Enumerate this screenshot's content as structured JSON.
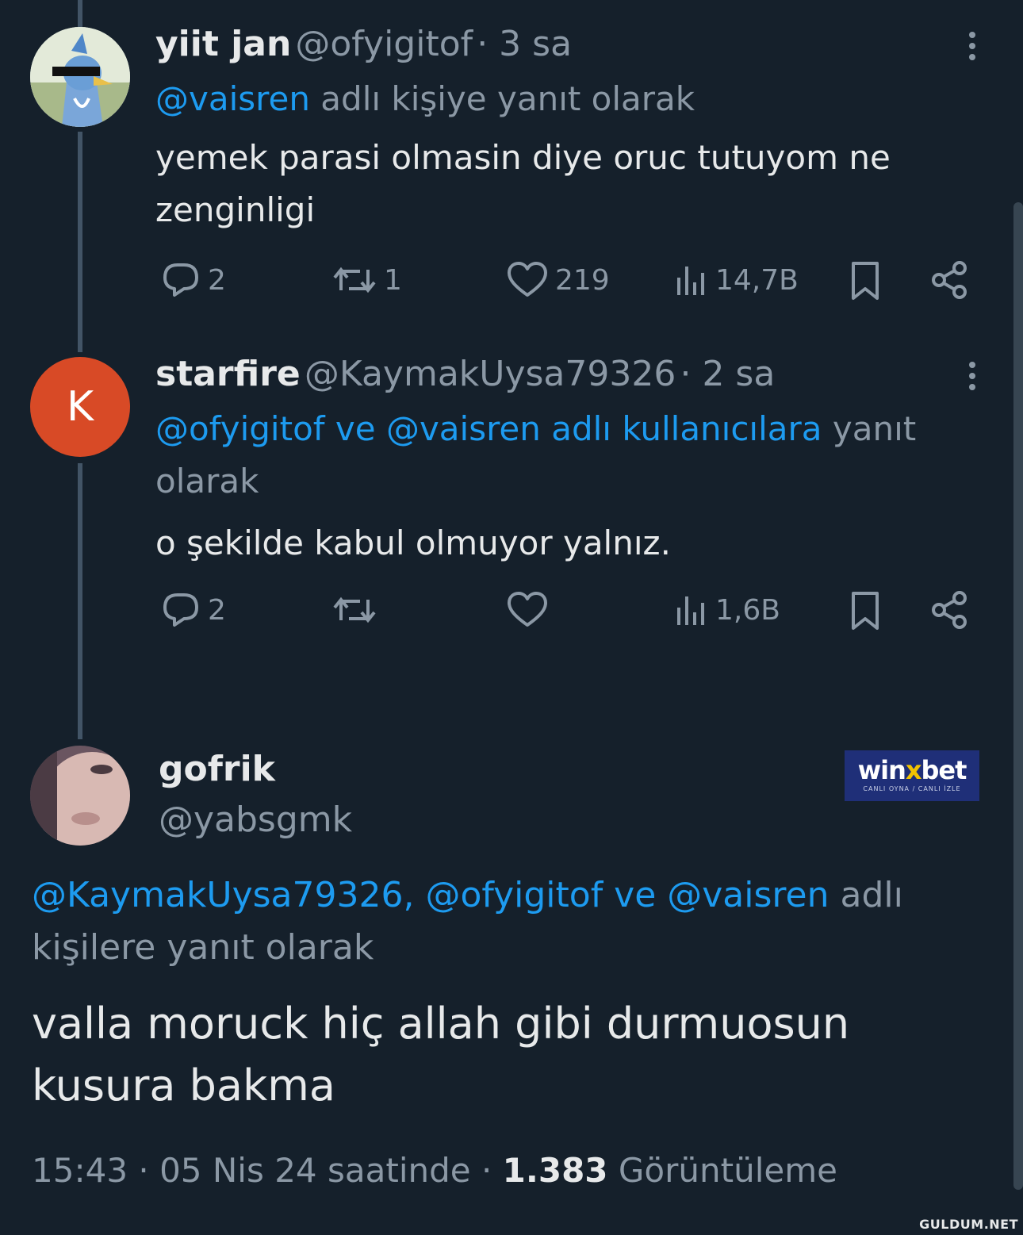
{
  "tweets": [
    {
      "name": "yiit jan",
      "handle": "@ofyigitof",
      "time": "· 3 sa",
      "reply_mentions": "@vaisren",
      "reply_suffix": " adlı kişiye yanıt olarak",
      "text": "yemek parasi olmasin diye oruc tutuyom ne zenginligi",
      "replies": "2",
      "retweets": "1",
      "likes": "219",
      "views": "14,7B"
    },
    {
      "name": "starfire",
      "handle": "@KaymakUysa79326",
      "time": "· 2 sa",
      "avatar_letter": "K",
      "reply_mentions": "@ofyigitof ve @vaisren adlı kullanıcılara",
      "reply_suffix": " yanıt olarak",
      "text": "o şekilde kabul olmuyor yalnız.",
      "replies": "2",
      "retweets": "",
      "likes": "",
      "views": "1,6B"
    }
  ],
  "main_tweet": {
    "name": "gofrik",
    "handle": "@yabsgmk",
    "reply_mentions": "@KaymakUysa79326, @ofyigitof ve @vaisren",
    "reply_suffix": " adlı kişilere yanıt olarak",
    "text": "valla moruck hiç allah gibi durmuosun kusura bakma",
    "timestamp": "15:43 · 05 Nis 24 saatinde · ",
    "views_count": "1.383",
    "views_label": " Görüntüleme"
  },
  "ad": {
    "logo_a": "win",
    "logo_x": "x",
    "logo_b": "bet",
    "tagline": "CANLI OYNA / CANLI İZLE"
  },
  "watermark": "GULDUM.NET",
  "colors": {
    "background": "#15202b",
    "link": "#1d9bf0",
    "muted": "#8b98a5",
    "avatar_k": "#d84a26"
  },
  "icons": [
    "reply-icon",
    "retweet-icon",
    "like-icon",
    "views-icon",
    "bookmark-icon",
    "share-icon",
    "more-icon"
  ]
}
